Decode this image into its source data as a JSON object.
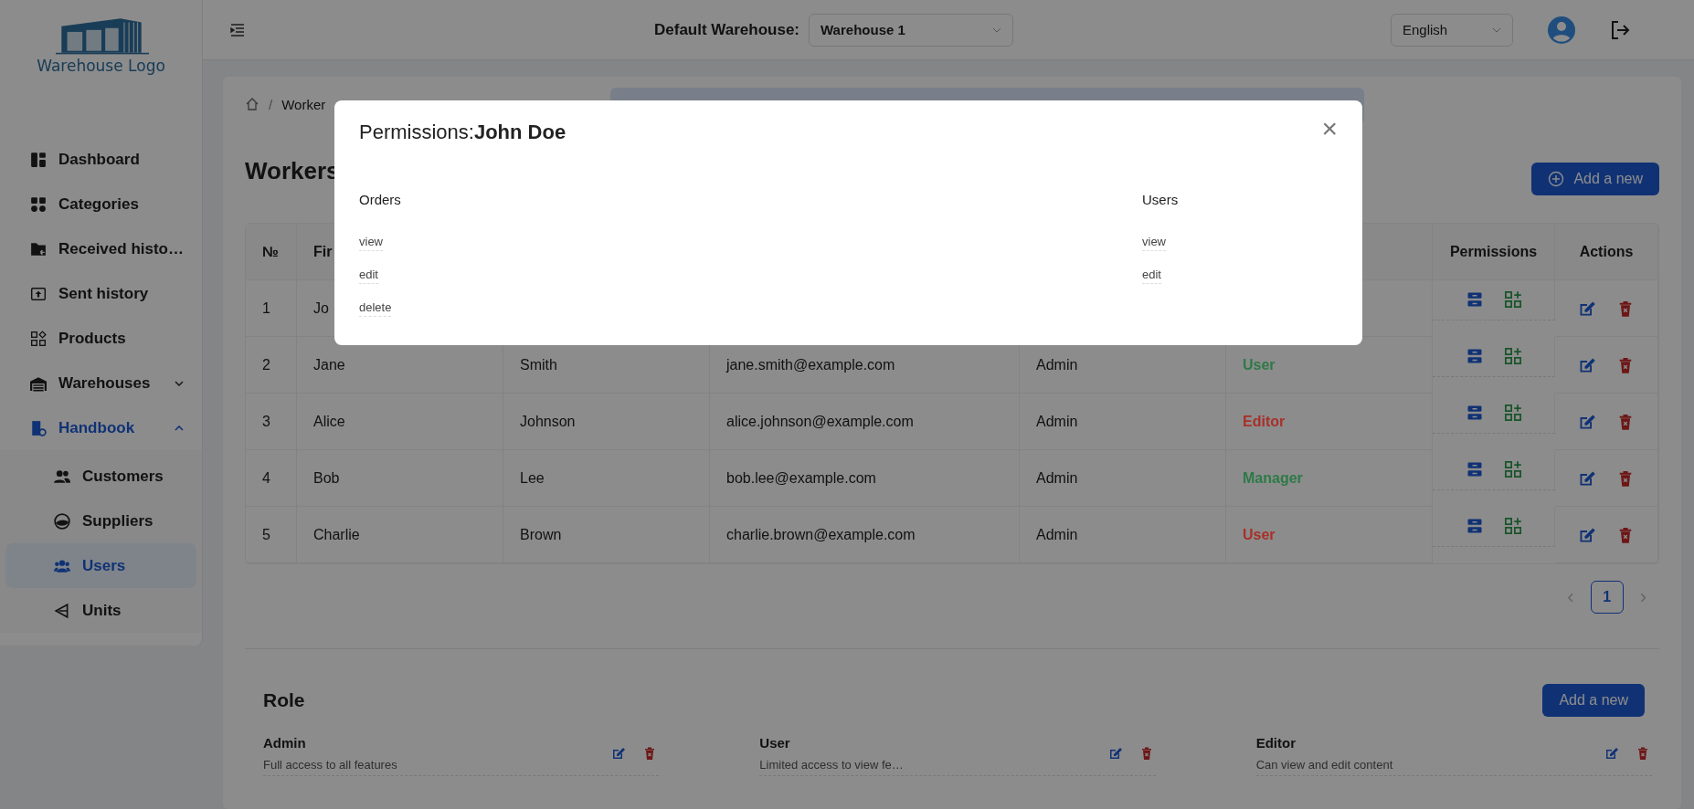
{
  "logo": {
    "text": "Warehouse Logo"
  },
  "sidebar": {
    "items": [
      {
        "label": "Dashboard",
        "selected": false
      },
      {
        "label": "Categories",
        "selected": false
      },
      {
        "label": "Received histo…",
        "selected": false
      },
      {
        "label": "Sent history",
        "selected": false
      },
      {
        "label": "Products",
        "selected": false
      },
      {
        "label": "Warehouses",
        "selected": false,
        "expanded": false
      },
      {
        "label": "Handbook",
        "selected": false,
        "expanded": true,
        "children": [
          {
            "label": "Customers",
            "selected": false
          },
          {
            "label": "Suppliers",
            "selected": false
          },
          {
            "label": "Users",
            "selected": true
          },
          {
            "label": "Units",
            "selected": false
          }
        ]
      }
    ]
  },
  "header": {
    "warehouse_label": "Default Warehouse:",
    "warehouse_select": "Warehouse 1",
    "language_select": "English"
  },
  "breadcrumb": {
    "separator": "/",
    "items": [
      "Worker"
    ]
  },
  "workers": {
    "title": "Workers",
    "add_button": "Add a new",
    "columns": [
      {
        "label": "№"
      },
      {
        "label": "Fir"
      },
      {
        "label": "Permissions",
        "kind": "permissions"
      },
      {
        "label": "Actions",
        "kind": "actions"
      }
    ],
    "rows": [
      {
        "cells": [
          "1",
          "Jo"
        ]
      },
      {
        "cells": [
          "2",
          "Jane",
          "Smith",
          "jane.smith@example.com",
          "Admin"
        ],
        "role": {
          "text": "User",
          "color": "#2d7a47"
        }
      },
      {
        "cells": [
          "3",
          "Alice",
          "Johnson",
          "alice.johnson@example.com",
          "Admin"
        ],
        "role": {
          "text": "Editor",
          "color": "#a8302a"
        }
      },
      {
        "cells": [
          "4",
          "Bob",
          "Lee",
          "bob.lee@example.com",
          "Admin"
        ],
        "role": {
          "text": "Manager",
          "color": "#2d7a47"
        }
      },
      {
        "cells": [
          "5",
          "Charlie",
          "Brown",
          "charlie.brown@example.com",
          "Admin"
        ],
        "role": {
          "text": "User",
          "color": "#a8302a"
        }
      }
    ],
    "pagination": {
      "prev": "‹",
      "pages": [
        {
          "label": "1",
          "selected": true
        }
      ],
      "next": "›"
    }
  },
  "roles": {
    "title": "Role",
    "add_button": "Add a new",
    "items": [
      {
        "name": "Admin",
        "description": "Full access to all features"
      },
      {
        "name": "User",
        "description": "Limited access to view fe…"
      },
      {
        "name": "Editor",
        "description": "Can view and edit content"
      }
    ]
  },
  "modal": {
    "title": "Permissions:**John Doe**",
    "close": "×",
    "groups": [
      {
        "name": "Orders",
        "permissions": [
          "view",
          "edit",
          "delete"
        ]
      },
      {
        "name": "Users",
        "permissions": [
          "view",
          "edit"
        ]
      }
    ]
  }
}
